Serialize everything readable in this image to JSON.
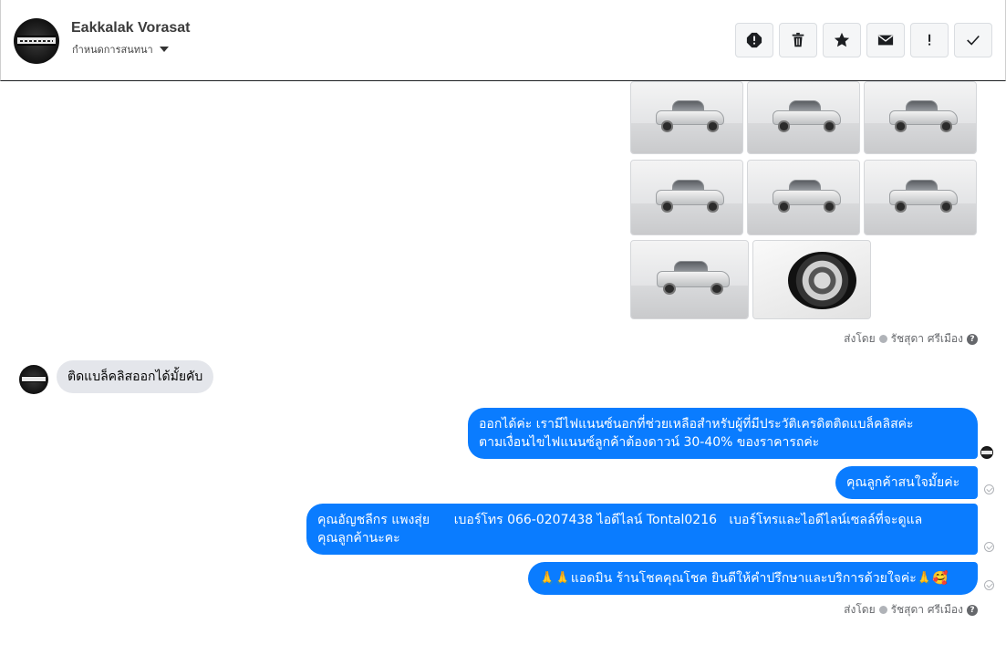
{
  "header": {
    "contact_name": "Eakkalak Vorasat",
    "assign_label": "กำหนดการสนทนา",
    "actions": [
      {
        "name": "report-icon",
        "label": "report"
      },
      {
        "name": "trash-icon",
        "label": "delete"
      },
      {
        "name": "star-icon",
        "label": "star"
      },
      {
        "name": "envelope-icon",
        "label": "mark unread"
      },
      {
        "name": "exclamation-icon",
        "label": "important"
      },
      {
        "name": "checkmark-icon",
        "label": "done"
      }
    ]
  },
  "chat": {
    "photos": [
      {
        "subject": "front",
        "icon": "truck-photo"
      },
      {
        "subject": "front-left",
        "icon": "truck-photo"
      },
      {
        "subject": "front-left",
        "icon": "truck-photo"
      },
      {
        "subject": "side",
        "icon": "truck-photo"
      },
      {
        "subject": "side",
        "icon": "truck-photo"
      },
      {
        "subject": "rear",
        "icon": "truck-photo"
      },
      {
        "subject": "rear",
        "icon": "truck-photo"
      },
      {
        "subject": "wheel",
        "icon": "wheel-photo"
      }
    ],
    "sent_by_1": {
      "prefix": "ส่งโดย",
      "agent": "รัชสุดา ศรีเมือง"
    },
    "incoming": "ติดแบล็คลิสออกได้มั้ยคับ",
    "outgoing": [
      {
        "line1": "ออกได้ค่ะ เรามีไฟแนนซ์นอกที่ช่วยเหลือสำหรับผู้ที่มีประวัติเครดิตติดแบล็คลิสค่ะ",
        "line2": "ตามเงื่อนไขไฟแนนซ์ลูกค้าต้องดาวน์ 30-40% ของราคารถค่ะ"
      },
      {
        "text": "คุณลูกค้าสนใจมั้ยค่ะ"
      },
      {
        "line1": "คุณอัญชลีกร แพงสุ่ย      เบอร์โทร 066-0207438 ไอดีไลน์ Tontal0216   เบอร์โทรและไอดีไลน์เซลล์ที่จะดูแล",
        "line2": "คุณลูกค้านะคะ"
      },
      {
        "text": "🙏🙏แอดมิน ร้านโชคคุณโชค ยินดีให้คำปรึกษาและบริการด้วยใจค่ะ🙏🥰"
      }
    ],
    "sent_by_2": {
      "prefix": "ส่งโดย",
      "agent": "รัชสุดา ศรีเมือง"
    },
    "colors": {
      "outgoing_bubble": "#0a7cff",
      "incoming_bubble": "#e4e6eb"
    }
  }
}
